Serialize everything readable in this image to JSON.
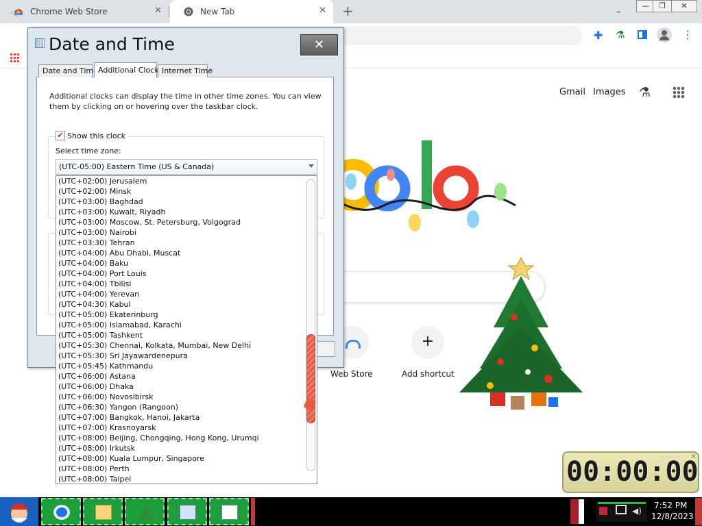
{
  "browser": {
    "tabs": [
      {
        "label": "Chrome Web Store"
      },
      {
        "label": "New Tab"
      }
    ],
    "new_tab_symbol": "+",
    "tab_close_symbol": "✕",
    "window_controls": {
      "minimize": "—",
      "maximize": "❐",
      "close": "✕"
    }
  },
  "newtab": {
    "gmail": "Gmail",
    "images": "Images",
    "shortcuts": [
      {
        "label": "Web Store"
      },
      {
        "label": "Add shortcut",
        "symbol": "+"
      }
    ]
  },
  "dialog": {
    "title": "Date and Time",
    "close_symbol": "✕",
    "tabs": [
      "Date and Time",
      "Additional Clocks",
      "Internet Time"
    ],
    "description": "Additional clocks can display the time in other time zones. You can view them by clicking on or hovering over the taskbar clock.",
    "show_clock_label": "Show this clock",
    "show_clock_checked": true,
    "checkmark": "✔",
    "timezone_label": "Select time zone:",
    "timezone_selected": "(UTC-05:00) Eastern Time (US & Canada)",
    "timezone_options": [
      "(UTC+02:00) Jerusalem",
      "(UTC+02:00) Minsk",
      "(UTC+03:00) Baghdad",
      "(UTC+03:00) Kuwait, Riyadh",
      "(UTC+03:00) Moscow, St. Petersburg, Volgograd",
      "(UTC+03:00) Nairobi",
      "(UTC+03:30) Tehran",
      "(UTC+04:00) Abu Dhabi, Muscat",
      "(UTC+04:00) Baku",
      "(UTC+04:00) Port Louis",
      "(UTC+04:00) Tbilisi",
      "(UTC+04:00) Yerevan",
      "(UTC+04:30) Kabul",
      "(UTC+05:00) Ekaterinburg",
      "(UTC+05:00) Islamabad, Karachi",
      "(UTC+05:00) Tashkent",
      "(UTC+05:30) Chennai, Kolkata, Mumbai, New Delhi",
      "(UTC+05:30) Sri Jayawardenepura",
      "(UTC+05:45) Kathmandu",
      "(UTC+06:00) Astana",
      "(UTC+06:00) Dhaka",
      "(UTC+06:00) Novosibirsk",
      "(UTC+06:30) Yangon (Rangoon)",
      "(UTC+07:00) Bangkok, Hanoi, Jakarta",
      "(UTC+07:00) Krasnoyarsk",
      "(UTC+08:00) Beijing, Chongqing, Hong Kong, Urumqi",
      "(UTC+08:00) Irkutsk",
      "(UTC+08:00) Kuala Lumpur, Singapore",
      "(UTC+08:00) Perth",
      "(UTC+08:00) Taipei"
    ]
  },
  "stopwatch": {
    "display": "00:00:00",
    "close_symbol": "✕"
  },
  "taskbar": {
    "time": "7:52 PM",
    "date": "12/8/2023"
  },
  "colors": {
    "accent": "#1a73e8",
    "taskbar": "#000000",
    "taskbar_button": "#1e9e3a",
    "scroll_thumb": "#e8563f"
  }
}
